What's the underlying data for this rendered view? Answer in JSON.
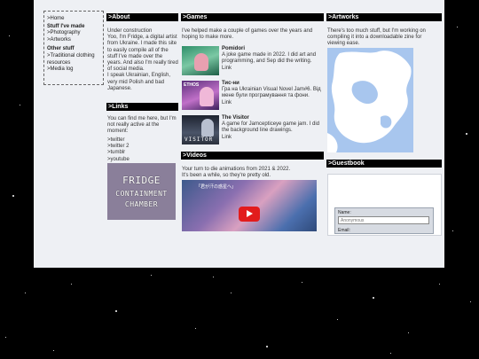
{
  "nav": {
    "home": ">Home",
    "section1": "Stuff I've made",
    "photography": ">Photography",
    "artworks": ">Artworks",
    "section2": "Other stuff",
    "clothing": ">Traditional clothing resources",
    "medialog": ">Media log"
  },
  "about": {
    "header": ">About",
    "text": "Under construction\nYoo, I'm Fridge, a digital artist from Ukraine. I made this site to easily compile all of the stuff I've made over the years. And also I'm really tired of social media.\nI speak Ukrainian, English, very mid Polish and bad Japanese."
  },
  "links": {
    "header": ">Links",
    "intro": "You can find me here, but I'm not really active at the moment:",
    "items": [
      ">twitter",
      ">twitter 2",
      ">tumblr",
      ">youtube"
    ],
    "badge_line1": "FRIDGE",
    "badge_line2": "CONTAINMENT",
    "badge_line3": "CHAMBER"
  },
  "games": {
    "header": ">Games",
    "intro": "I've helped make a couple of games over the years and hoping to make more.",
    "items": [
      {
        "title": "Pomidori",
        "desc": "A joke game made in 2022. I did art and programming, and Sep did the writing.",
        "link": "Link",
        "thumb_text": ""
      },
      {
        "title": "Тис-ни",
        "desc": "Гра на Ukrainian Visual Novel Jam#6. Від мене були програмування та фони.",
        "link": "Link",
        "thumb_text": "ETHOS"
      },
      {
        "title": "The Visitor",
        "desc": "A game for Jamсерticeye game jam. I did the background line drawings.",
        "link": "Link",
        "thumb_text": "VISITOR"
      }
    ]
  },
  "videos": {
    "header": ">Videos",
    "line1": "Your turn to die animations from 2021 & 2022.",
    "line2": "It's been a while, so they're pretty old.",
    "video_title": "「君が汗の惑星へ」"
  },
  "artworks": {
    "header": ">Artworks",
    "text": "There's too much stuff, but I'm working on compiling it into a downloadable zine for viewing ease."
  },
  "guestbook": {
    "header": ">Guestbook",
    "name_label": "Name:",
    "name_placeholder": "Anonymous",
    "email_label": "Email:"
  },
  "colors": {
    "background": "#000000",
    "panel": "#eef0f4",
    "header": "#000000",
    "accent": "#e21c1c"
  }
}
